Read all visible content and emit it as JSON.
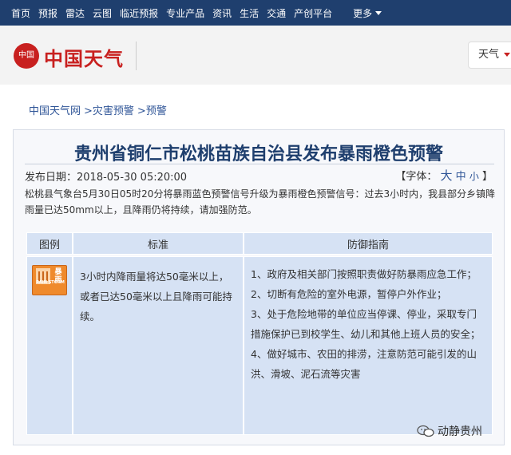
{
  "topnav": {
    "items": [
      "首页",
      "预报",
      "雷达",
      "云图",
      "临近预报",
      "专业产品",
      "资讯",
      "生活",
      "交通",
      "产创平台"
    ],
    "more": "更多"
  },
  "header": {
    "logo_seal": "中国",
    "logo_text": "中国天气",
    "city_select": "天气"
  },
  "breadcrumb": [
    "中国天气网",
    ">灾害预警",
    ">预警"
  ],
  "article": {
    "title": "贵州省铜仁市松桃苗族自治县发布暴雨橙色预警",
    "publish_date": "发布日期：2018-05-30 05:20:00",
    "font_label": "【字体：",
    "font_big": "大",
    "font_mid": "中",
    "font_small": "小",
    "font_close": "】",
    "notice": "松桃县气象台5月30日05时20分将暴雨蓝色预警信号升级为暴雨橙色预警信号：过去3小时内，我县部分乡镇降雨量已达50mm以上，且降雨仍将持续，请加强防范。"
  },
  "table": {
    "headers": [
      "图例",
      "标准",
      "防御指南"
    ],
    "icon": {
      "name": "rainstorm-orange-warning-icon",
      "text_cn": "暴雨",
      "text_en": "RAIN STORM",
      "color": "#ef8a2c"
    },
    "standard": "3小时内降雨量将达50毫米以上，或者已达50毫米以上且降雨可能持续。",
    "guide": [
      "1、政府及相关部门按照职责做好防暴雨应急工作；",
      "2、切断有危险的室外电源，暂停户外作业；",
      "3、处于危险地带的单位应当停课、停业，采取专门措施保护已到校学生、幼儿和其他上班人员的安全；",
      "4、做好城市、农田的排涝，注意防范可能引发的山洪、滑坡、泥石流等灾害"
    ]
  },
  "watermark": "动静贵州",
  "colors": {
    "nav_bg": "#1f3f6e",
    "brand_red": "#c8201f",
    "link_blue": "#2f5597",
    "table_bg": "#d6e2f4"
  }
}
